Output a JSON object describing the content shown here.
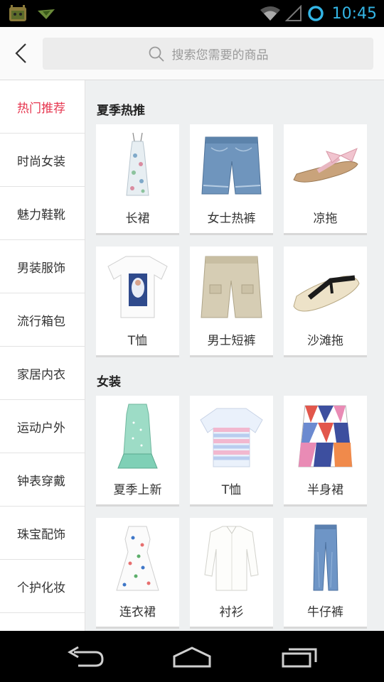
{
  "status_bar": {
    "time": "10:45",
    "icons": [
      "android-app-icon",
      "notification-icon",
      "wifi-icon",
      "signal-icon",
      "sync-icon"
    ]
  },
  "header": {
    "back_icon": "chevron-left-icon",
    "search_placeholder": "搜索您需要的商品"
  },
  "sidebar": {
    "items": [
      {
        "label": "热门推荐",
        "active": true
      },
      {
        "label": "时尚女装"
      },
      {
        "label": "魅力鞋靴"
      },
      {
        "label": "男装服饰"
      },
      {
        "label": "流行箱包"
      },
      {
        "label": "家居内衣"
      },
      {
        "label": "运动户外"
      },
      {
        "label": "钟表穿戴"
      },
      {
        "label": "珠宝配饰"
      },
      {
        "label": "个护化妆"
      }
    ]
  },
  "sections": [
    {
      "title": "夏季热推",
      "items": [
        {
          "label": "长裙",
          "image": "long-dress"
        },
        {
          "label": "女士热裤",
          "image": "denim-shorts"
        },
        {
          "label": "凉拖",
          "image": "bow-slipper"
        },
        {
          "label": "T恤",
          "image": "graphic-tshirt"
        },
        {
          "label": "男士短裤",
          "image": "khaki-shorts"
        },
        {
          "label": "沙滩拖",
          "image": "flip-flop"
        }
      ]
    },
    {
      "title": "女装",
      "items": [
        {
          "label": "夏季上新",
          "image": "mint-dress"
        },
        {
          "label": "T恤",
          "image": "pastel-top"
        },
        {
          "label": "半身裙",
          "image": "geo-skirt"
        },
        {
          "label": "连衣裙",
          "image": "floral-dress"
        },
        {
          "label": "衬衫",
          "image": "white-shirt"
        },
        {
          "label": "牛仔裤",
          "image": "jeans"
        }
      ]
    }
  ],
  "nav_bar": {
    "buttons": [
      "back-nav-icon",
      "home-nav-icon",
      "recents-nav-icon"
    ]
  },
  "colors": {
    "accent": "#e6364f",
    "clock": "#33b5e5",
    "content_bg": "#eef0f1"
  }
}
